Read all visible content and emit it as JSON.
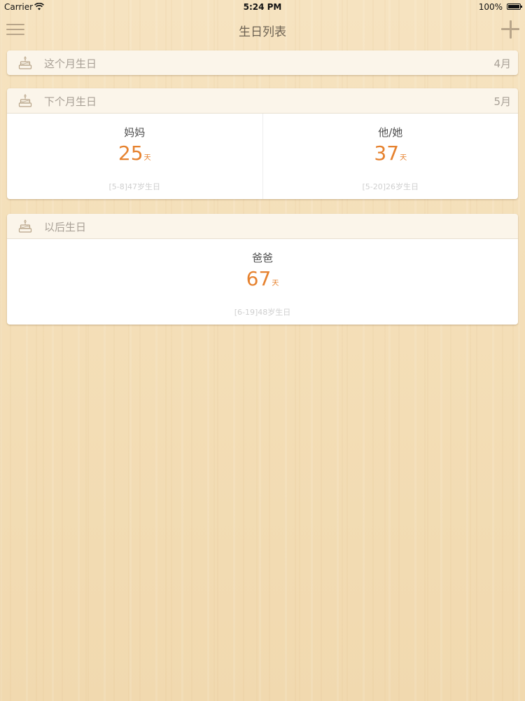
{
  "status_bar": {
    "carrier": "Carrier",
    "time": "5:24 PM",
    "battery": "100%"
  },
  "nav": {
    "title": "生日列表",
    "menu_icon": "hamburger-menu-icon",
    "add_icon": "plus-icon"
  },
  "colors": {
    "accent": "#e6822f",
    "background": "#f3dfb9",
    "header_bg": "#fbf5ea",
    "icon_color": "#b8a58a"
  },
  "sections": [
    {
      "title": "这个月生日",
      "month": "4月",
      "people": []
    },
    {
      "title": "下个月生日",
      "month": "5月",
      "people": [
        {
          "name": "妈妈",
          "days": "25",
          "unit": "天",
          "detail": "[5-8]47岁生日"
        },
        {
          "name": "他/她",
          "days": "37",
          "unit": "天",
          "detail": "[5-20]26岁生日"
        }
      ]
    },
    {
      "title": "以后生日",
      "month": "",
      "people": [
        {
          "name": "爸爸",
          "days": "67",
          "unit": "天",
          "detail": "[6-19]48岁生日"
        }
      ]
    }
  ]
}
